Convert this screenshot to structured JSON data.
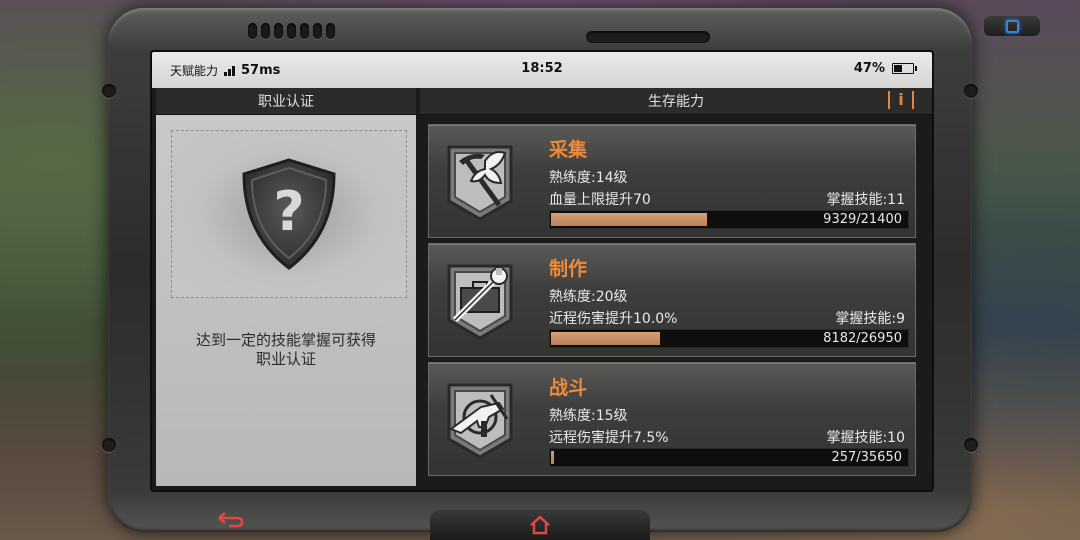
{
  "status_bar": {
    "app_label": "天赋能力",
    "ping": "57ms",
    "time": "18:52",
    "battery": "47%",
    "battery_level": 0.47
  },
  "left_panel": {
    "header": "职业认证",
    "icon": "question-shield-icon",
    "description_line1": "达到一定的技能掌握可获得",
    "description_line2": "职业认证"
  },
  "right_panel": {
    "header": "生存能力",
    "info_icon": "info-icon"
  },
  "skills": [
    {
      "icon": "gathering-pickaxe-leaf-icon",
      "name": "采集",
      "level": "熟练度:14级",
      "bonus": "血量上限提升70",
      "mastery": "掌握技能:11",
      "xp_current": 9329,
      "xp_total": 21400,
      "xp_text": "9329/21400"
    },
    {
      "icon": "crafting-wrench-toolbox-icon",
      "name": "制作",
      "level": "熟练度:20级",
      "bonus": "近程伤害提升10.0%",
      "mastery": "掌握技能:9",
      "xp_current": 8182,
      "xp_total": 26950,
      "xp_text": "8182/26950"
    },
    {
      "icon": "combat-gun-icon",
      "name": "战斗",
      "level": "熟练度:15级",
      "bonus": "远程伤害提升7.5%",
      "mastery": "掌握技能:10",
      "xp_current": 257,
      "xp_total": 35650,
      "xp_text": "257/35650"
    }
  ],
  "bottom_nav": {
    "back_icon": "back-arrow-icon",
    "home_icon": "home-icon"
  },
  "colors": {
    "accent": "#f08a38",
    "xp_fill": "#c68e65",
    "panel_bg": "#3e3e3c"
  }
}
